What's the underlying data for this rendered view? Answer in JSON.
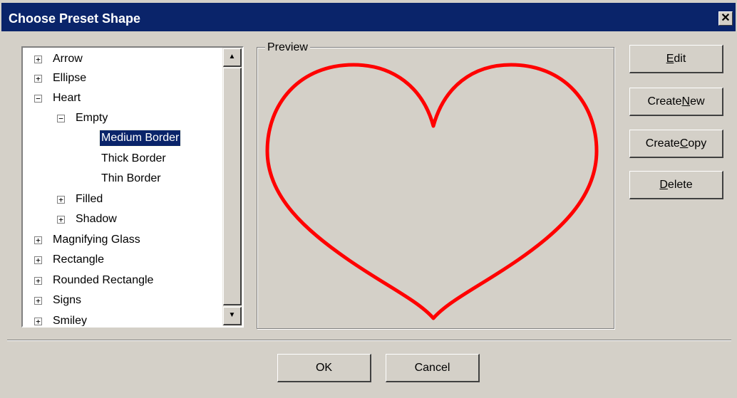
{
  "window": {
    "title": "Choose Preset Shape",
    "close_glyph": "✕"
  },
  "tree": {
    "items": [
      {
        "label": "Arrow",
        "expander": "+"
      },
      {
        "label": "Ellipse",
        "expander": "+"
      },
      {
        "label": "Heart",
        "expander": "−"
      },
      {
        "label": "Empty",
        "expander": "−"
      },
      {
        "label": "Medium Border",
        "selected": true
      },
      {
        "label": "Thick Border"
      },
      {
        "label": "Thin Border"
      },
      {
        "label": "Filled",
        "expander": "+"
      },
      {
        "label": "Shadow",
        "expander": "+"
      },
      {
        "label": "Magnifying Glass",
        "expander": "+"
      },
      {
        "label": "Rectangle",
        "expander": "+"
      },
      {
        "label": "Rounded Rectangle",
        "expander": "+"
      },
      {
        "label": "Signs",
        "expander": "+"
      },
      {
        "label": "Smiley",
        "expander": "+"
      }
    ]
  },
  "scrollbar": {
    "up_glyph": "▲",
    "down_glyph": "▼"
  },
  "preview": {
    "label": "Preview",
    "shape_stroke": "#ff0000"
  },
  "buttons": {
    "edit": {
      "pre": "",
      "key": "E",
      "post": "dit"
    },
    "create_new": {
      "pre": "Create ",
      "key": "N",
      "post": "ew"
    },
    "create_copy": {
      "pre": "Create ",
      "key": "C",
      "post": "opy"
    },
    "delete": {
      "pre": "",
      "key": "D",
      "post": "elete"
    },
    "ok": "OK",
    "cancel": "Cancel"
  }
}
